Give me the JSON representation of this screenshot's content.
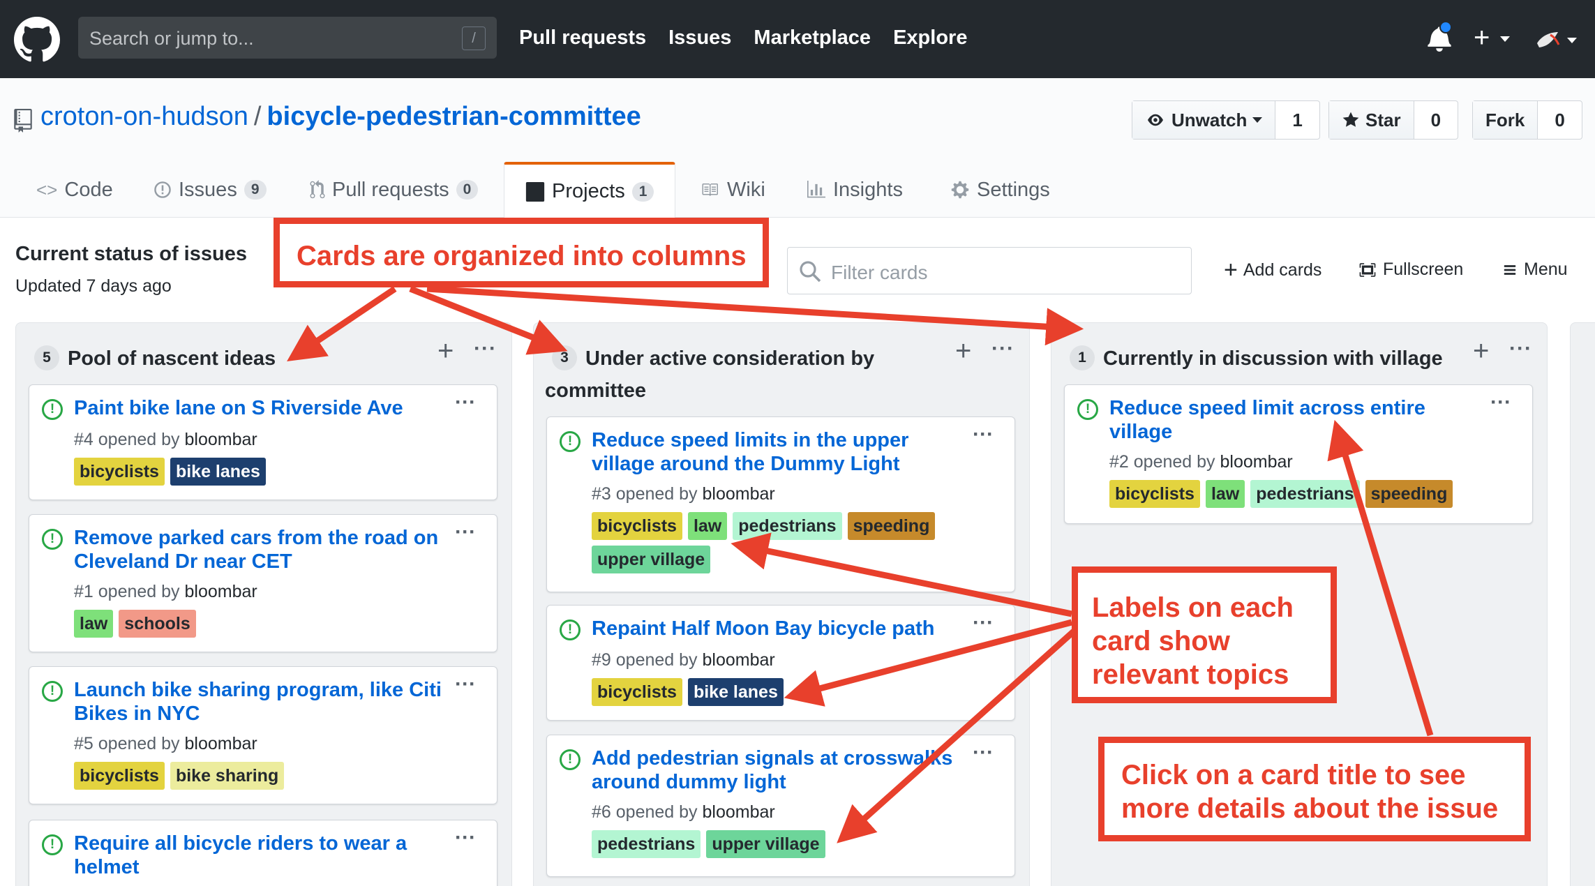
{
  "topbar": {
    "search_placeholder": "Search or jump to...",
    "search_shortcut": "/",
    "nav": [
      "Pull requests",
      "Issues",
      "Marketplace",
      "Explore"
    ],
    "plus_label": "+"
  },
  "repo": {
    "owner": "croton-on-hudson",
    "separator": "/",
    "name": "bicycle-pedestrian-committee",
    "unwatch_label": "Unwatch",
    "unwatch_count": "1",
    "star_label": "Star",
    "star_count": "0",
    "fork_label": "Fork",
    "fork_count": "0"
  },
  "tabs": [
    {
      "label": "Code",
      "count": null
    },
    {
      "label": "Issues",
      "count": "9"
    },
    {
      "label": "Pull requests",
      "count": "0"
    },
    {
      "label": "Projects",
      "count": "1"
    },
    {
      "label": "Wiki",
      "count": null
    },
    {
      "label": "Insights",
      "count": null
    },
    {
      "label": "Settings",
      "count": null
    }
  ],
  "project": {
    "name": "Current status of issues",
    "updated": "Updated 7 days ago",
    "filter_placeholder": "Filter cards",
    "add_cards": "Add cards",
    "fullscreen": "Fullscreen",
    "menu": "Menu"
  },
  "columns": [
    {
      "count": "5",
      "title": "Pool of nascent ideas",
      "cards": [
        {
          "title": "Paint bike lane on S Riverside Ave",
          "number": "#4",
          "opened_by": "opened by",
          "user": "bloombar",
          "labels": [
            "bicyclists",
            "bike lanes"
          ]
        },
        {
          "title": "Remove parked cars from the road on Cleveland Dr near CET",
          "number": "#1",
          "opened_by": "opened by",
          "user": "bloombar",
          "labels": [
            "law",
            "schools"
          ]
        },
        {
          "title": "Launch bike sharing program, like Citi Bikes in NYC",
          "number": "#5",
          "opened_by": "opened by",
          "user": "bloombar",
          "labels": [
            "bicyclists",
            "bike sharing"
          ]
        },
        {
          "title": "Require all bicycle riders to wear a helmet"
        }
      ]
    },
    {
      "count": "3",
      "title": "Under active consideration by committee",
      "cards": [
        {
          "title": "Reduce speed limits in the upper village around the Dummy Light",
          "number": "#3",
          "opened_by": "opened by",
          "user": "bloombar",
          "labels": [
            "bicyclists",
            "law",
            "pedestrians",
            "speeding",
            "upper village"
          ]
        },
        {
          "title": "Repaint Half Moon Bay bicycle path",
          "number": "#9",
          "opened_by": "opened by",
          "user": "bloombar",
          "labels": [
            "bicyclists",
            "bike lanes"
          ]
        },
        {
          "title": "Add pedestrian signals at crosswalks around dummy light",
          "number": "#6",
          "opened_by": "opened by",
          "user": "bloombar",
          "labels": [
            "pedestrians",
            "upper village"
          ]
        }
      ]
    },
    {
      "count": "1",
      "title": "Currently in discussion with village",
      "cards": [
        {
          "title": "Reduce speed limit across entire village",
          "number": "#2",
          "opened_by": "opened by",
          "user": "bloombar",
          "labels": [
            "bicyclists",
            "law",
            "pedestrians",
            "speeding"
          ]
        }
      ]
    }
  ],
  "label_colors": {
    "bicyclists": {
      "bg": "#e3d33f",
      "fg": "#24292e"
    },
    "bike lanes": {
      "bg": "#1d3f6e",
      "fg": "#ffffff"
    },
    "law": {
      "bg": "#7ee07a",
      "fg": "#24292e"
    },
    "schools": {
      "bg": "#f29988",
      "fg": "#24292e"
    },
    "bike sharing": {
      "bg": "#ecec9d",
      "fg": "#24292e"
    },
    "pedestrians": {
      "bg": "#b3f5d2",
      "fg": "#24292e"
    },
    "speeding": {
      "bg": "#c68a2b",
      "fg": "#24292e"
    },
    "upper village": {
      "bg": "#6dd59a",
      "fg": "#24292e"
    }
  },
  "annotations": {
    "columns_note": "Cards are organized into columns",
    "labels_note": "Labels on each card show relevant topics",
    "title_note": "Click on a card title to see more details about the issue",
    "color": "#e8402c"
  }
}
